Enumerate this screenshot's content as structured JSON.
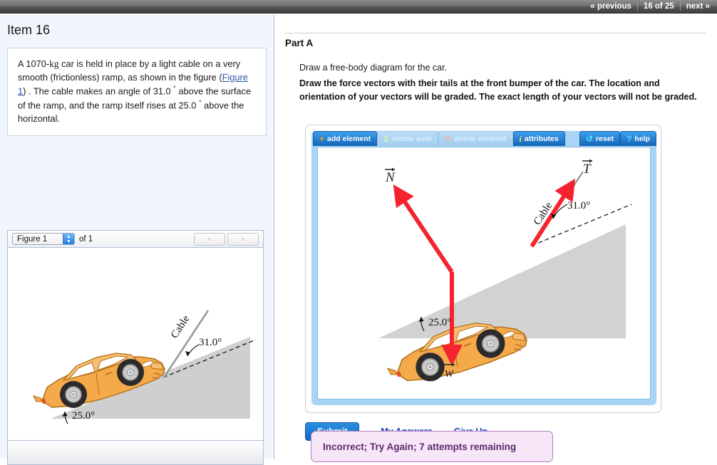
{
  "topnav": {
    "previous_label": "« previous",
    "counter": "16 of 25",
    "next_label": "next »"
  },
  "left": {
    "item_title": "Item 16",
    "problem": {
      "part1": "A 1070-",
      "kg": "kg",
      "part2": " car is held in place by a light cable on a very smooth (frictionless) ramp, as shown in the figure (",
      "figure_link": "Figure 1",
      "part3": ") . The cable makes an angle of 31.0 ",
      "deg1": "°",
      "part4": " above the surface of the ramp, and the ramp itself rises at 25.0 ",
      "deg2": "°",
      "part5": " above the horizontal."
    },
    "figure_panel": {
      "select_value": "Figure 1",
      "of_label": "of 1",
      "prev_arrow": "‹",
      "next_arrow": "›",
      "diagram": {
        "cable_label": "Cable",
        "cable_angle": "31.0°",
        "ramp_angle": "25.0°"
      }
    }
  },
  "right": {
    "part_title": "Part A",
    "instruction_plain": "Draw a free-body diagram for the car.",
    "instruction_bold": "Draw the force vectors with their tails at the front bumper of the car. The location and orientation of your vectors will be graded. The exact length of your vectors will not be graded.",
    "toolbar": [
      {
        "label": "add element",
        "icon": "plus-icon",
        "glyph": "+",
        "state": "active"
      },
      {
        "label": "vector sum",
        "icon": "sigma-icon",
        "glyph": "Σ",
        "state": "disabled"
      },
      {
        "label": "delete element",
        "icon": "x-icon",
        "glyph": "✕",
        "state": "disabled"
      },
      {
        "label": "attributes",
        "icon": "info-icon",
        "glyph": "i",
        "state": "active"
      },
      {
        "label": "reset",
        "icon": "reset-icon",
        "glyph": "↺",
        "state": "active"
      },
      {
        "label": "help",
        "icon": "help-icon",
        "glyph": "?",
        "state": "active"
      }
    ],
    "fbd": {
      "label_normal": "N",
      "label_tension": "T",
      "label_weight": "w",
      "cable_label": "Cable",
      "cable_angle": "31.0°",
      "ramp_angle": "25.0°"
    },
    "submit_label": "Submit",
    "my_answers_label": "My Answers",
    "give_up_label": "Give Up",
    "feedback": "Incorrect; Try Again; 7 attempts remaining"
  },
  "colors": {
    "vector_red": "#f5232f",
    "car_orange": "#f0a košík"
  }
}
